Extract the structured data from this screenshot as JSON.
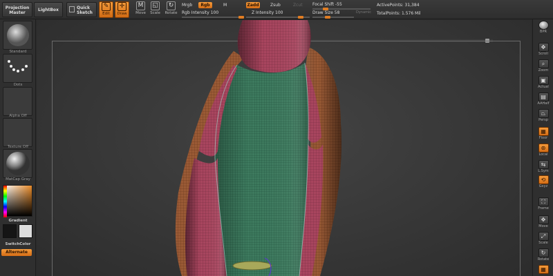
{
  "topbar": {
    "projection_master": "Projection\nMaster",
    "lightbox": "LightBox",
    "quick_sketch": "Quick\nSketch",
    "edit": "Edit",
    "draw": "Draw",
    "move": "Move",
    "scale": "Scale",
    "rotate": "Rotate",
    "mrgb": "Mrgb",
    "rgb": "Rgb",
    "m": "M",
    "rgb_intensity": "Rgb Intensity 100",
    "zadd": "Zadd",
    "zsub": "Zsub",
    "zcut": "Zcut",
    "z_intensity": "Z Intensity 100",
    "focal_shift": "Focal Shift -55",
    "draw_size": "Draw Size 58",
    "dynamic": "Dynamic",
    "active_points": "ActivePoints: 31,384",
    "total_points": "TotalPoints: 1.576 Mil"
  },
  "leftshelf": {
    "brush_label": "Standard",
    "stroke_label": "Dots",
    "alpha_label": "Alpha Off",
    "texture_label": "Texture Off",
    "material_label": "MatCap Gray",
    "gradient": "Gradient",
    "switch_color": "SwitchColor",
    "alternate": "Alternate"
  },
  "rightshelf": {
    "buttons": [
      {
        "label": "BPR",
        "icon": "render-sphere"
      },
      {
        "label": "Scroll",
        "icon": "scroll-icon"
      },
      {
        "label": "Zoom",
        "icon": "zoom-icon"
      },
      {
        "label": "Actual",
        "icon": "actual-icon"
      },
      {
        "label": "AAHalf",
        "icon": "aahalf-icon"
      },
      {
        "label": "Persp",
        "icon": "persp-icon"
      },
      {
        "label": "Floor",
        "icon": "floor-icon"
      },
      {
        "label": "Local",
        "icon": "local-icon"
      },
      {
        "label": "L.Sym",
        "icon": "lsym-icon"
      },
      {
        "label": "Gxyz",
        "icon": "gxyz-icon"
      },
      {
        "label": "Frame",
        "icon": "frame-icon"
      },
      {
        "label": "Move",
        "icon": "move-icon"
      },
      {
        "label": "Scale",
        "icon": "scale-icon"
      },
      {
        "label": "Rotate",
        "icon": "rotate-icon"
      }
    ]
  },
  "colors": {
    "accent": "#e07d23",
    "mesh_red": "#a8455e",
    "mesh_green": "#3d7a5e",
    "mesh_bronze": "#9a5a35",
    "background": "#2b2b2b"
  }
}
